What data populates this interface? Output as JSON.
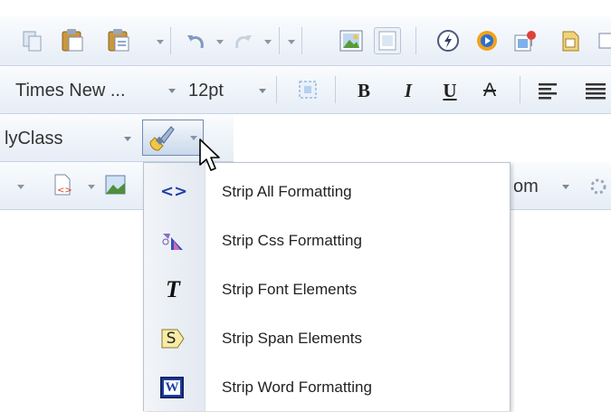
{
  "toolbar": {
    "font_name": "Times New ...",
    "font_size": "12pt",
    "style_class": "lyClass",
    "zoom_partial": "om",
    "bold": "B",
    "italic": "I",
    "underline": "U",
    "strike": "A"
  },
  "strip_menu": {
    "items": [
      {
        "label": "Strip All Formatting",
        "icon": "<>"
      },
      {
        "label": "Strip Css Formatting",
        "icon": "css-strip-icon"
      },
      {
        "label": "Strip Font Elements",
        "icon": "T"
      },
      {
        "label": "Strip Span Elements",
        "icon": "S"
      },
      {
        "label": "Strip Word Formatting",
        "icon": "W"
      }
    ]
  },
  "colors": {
    "toolbar_top": "#fafcfe",
    "toolbar_bottom": "#e6edf6",
    "menu_border": "#b9c3d0",
    "accent_blue": "#1f3fa8"
  }
}
